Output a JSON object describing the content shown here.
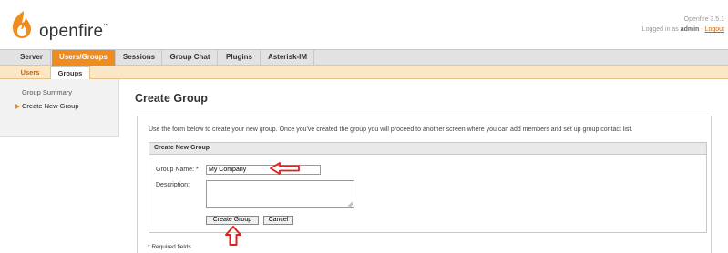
{
  "header": {
    "logo_text": "openfire",
    "logo_tm": "™",
    "version": "Openfire 3.5.1",
    "logged_in_prefix": "Logged in as",
    "user": "admin",
    "separator": " - ",
    "logout": "Logout"
  },
  "mainnav": {
    "tabs": [
      {
        "label": "Server",
        "active": false
      },
      {
        "label": "Users/Groups",
        "active": true
      },
      {
        "label": "Sessions",
        "active": false
      },
      {
        "label": "Group Chat",
        "active": false
      },
      {
        "label": "Plugins",
        "active": false
      },
      {
        "label": "Asterisk-IM",
        "active": false
      }
    ]
  },
  "subnav": {
    "tabs": [
      {
        "label": "Users",
        "active": false
      },
      {
        "label": "Groups",
        "active": true
      }
    ]
  },
  "sidebar": {
    "items": [
      {
        "label": "Group Summary",
        "active": false
      },
      {
        "label": "Create New Group",
        "active": true
      }
    ]
  },
  "main": {
    "title": "Create Group",
    "intro": "Use the form below to create your new group. Once you've created the group you will proceed to another screen where you can add members and set up group contact list.",
    "panel_title": "Create New Group",
    "group_name_label": "Group Name:",
    "required_mark": "*",
    "group_name_value": "My Company",
    "description_label": "Description:",
    "description_value": "",
    "create_button": "Create Group",
    "cancel_button": "Cancel",
    "required_note": "* Required fields"
  },
  "colors": {
    "brand_orange": "#f08c1e",
    "annotation_red": "#e0201e"
  },
  "icons": {
    "logo": "openfire-flame-icon",
    "arrow_left": "red-arrow-left-annotation",
    "arrow_up": "red-arrow-up-annotation"
  }
}
